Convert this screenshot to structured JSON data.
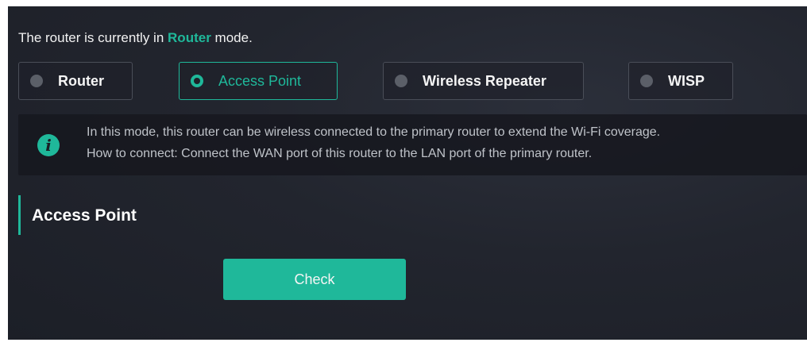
{
  "status": {
    "prefix": "The router is currently in",
    "current_mode": "Router",
    "suffix": "mode."
  },
  "modes": [
    {
      "label": "Router",
      "selected": false
    },
    {
      "label": "Access Point",
      "selected": true
    },
    {
      "label": "Wireless Repeater",
      "selected": false
    },
    {
      "label": "WISP",
      "selected": false
    }
  ],
  "info": {
    "icon": "info-icon",
    "line1": "In this mode, this router can be wireless connected to the primary router to extend the Wi-Fi coverage.",
    "line2": "How to connect: Connect the WAN port of this router to the LAN port of the primary router."
  },
  "section": {
    "title": "Access Point"
  },
  "actions": {
    "check_label": "Check"
  },
  "colors": {
    "accent": "#1fb89a",
    "background": "#22252e"
  }
}
